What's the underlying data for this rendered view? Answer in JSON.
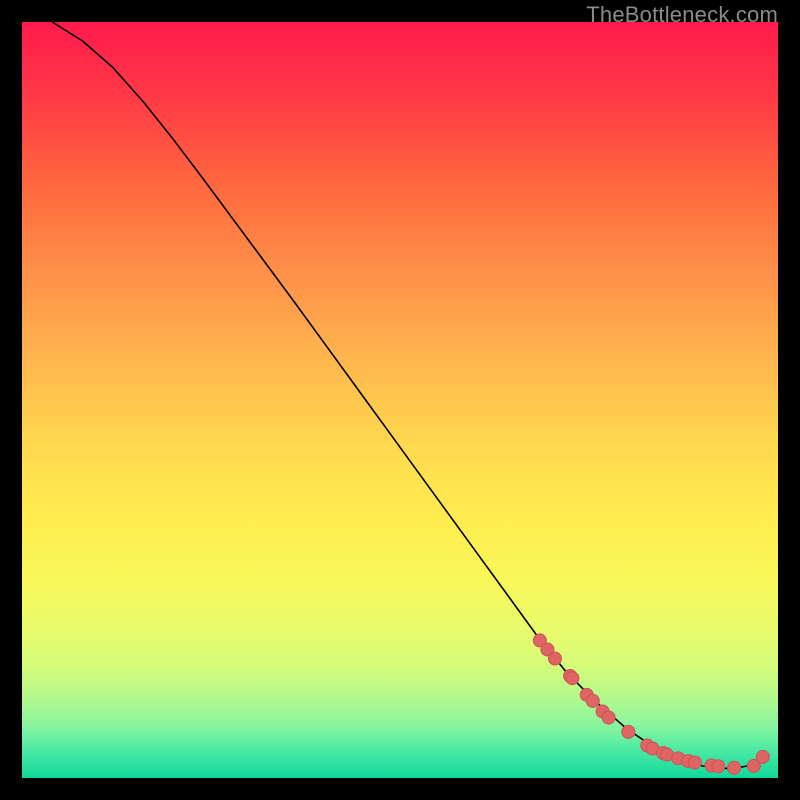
{
  "watermark": "TheBottleneck.com",
  "colors": {
    "curve_stroke": "#000000",
    "marker_fill": "#e06464",
    "marker_stroke": "#c95555"
  },
  "chart_data": {
    "type": "line",
    "title": "",
    "xlabel": "",
    "ylabel": "",
    "xlim": [
      0,
      100
    ],
    "ylim": [
      0,
      100
    ],
    "grid": false,
    "series": [
      {
        "name": "curve",
        "x": [
          4,
          8,
          12,
          16,
          20,
          24,
          28,
          32,
          36,
          40,
          44,
          48,
          52,
          56,
          60,
          64,
          68,
          72,
          76,
          80,
          84,
          86,
          88,
          90,
          92,
          94,
          96,
          98
        ],
        "y": [
          100,
          97.5,
          94,
          89.5,
          84.5,
          79.2,
          73.8,
          68.4,
          63,
          57.5,
          52,
          46.5,
          41,
          35.5,
          30,
          24.5,
          19,
          14,
          10,
          6.5,
          3.8,
          2.8,
          2.1,
          1.6,
          1.3,
          1.25,
          1.6,
          2.8
        ]
      }
    ],
    "markers": {
      "name": "dots",
      "x": [
        68.5,
        69.5,
        70.5,
        72.5,
        72.8,
        74.7,
        75.5,
        76.8,
        77.6,
        80.2,
        82.7,
        83.4,
        84.8,
        85.3,
        86.8,
        88.1,
        89.0,
        91.2,
        92.1,
        94.2,
        96.8,
        98.0
      ],
      "y": [
        18.2,
        17.0,
        15.8,
        13.5,
        13.2,
        11.0,
        10.2,
        8.8,
        8.0,
        6.1,
        4.3,
        3.9,
        3.3,
        3.1,
        2.6,
        2.25,
        2.05,
        1.65,
        1.55,
        1.35,
        1.6,
        2.8
      ]
    }
  }
}
